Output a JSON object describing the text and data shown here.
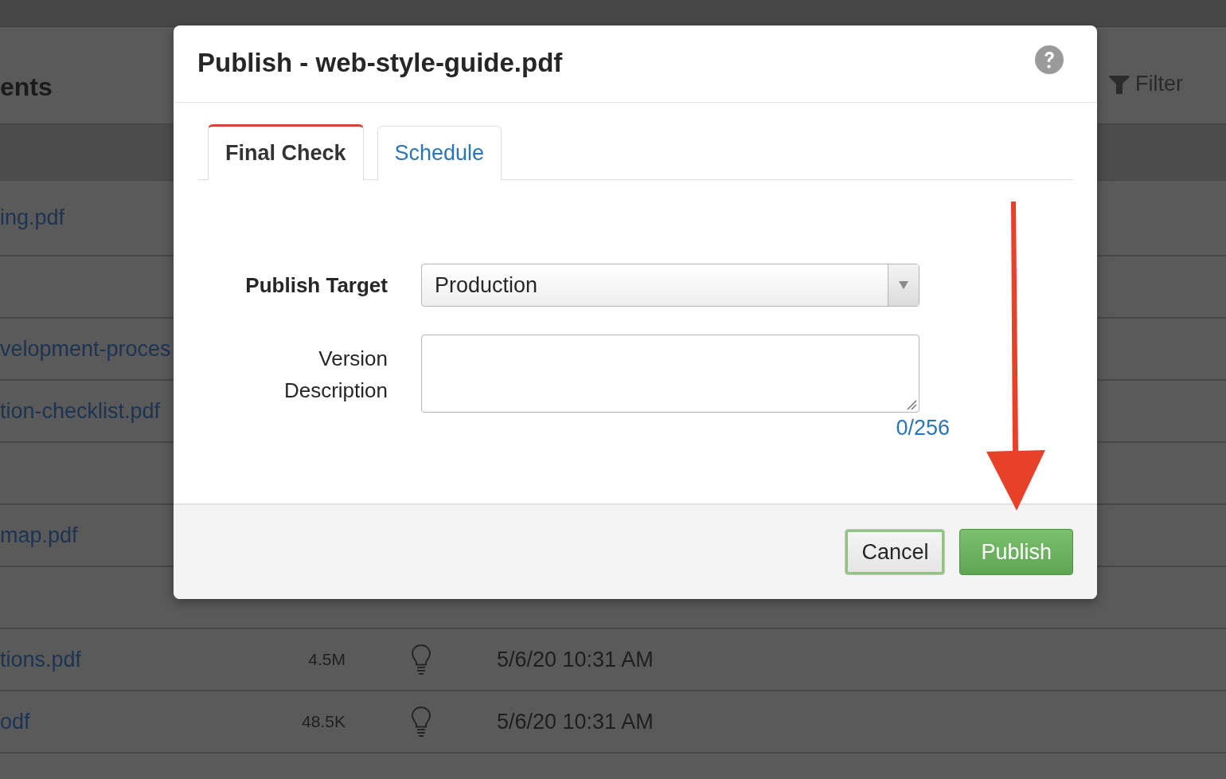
{
  "page": {
    "heading": "ents",
    "filter": "Filter"
  },
  "table": {
    "rows": [
      {
        "name": "ing.pdf"
      },
      {},
      {
        "name": "velopment-proces"
      },
      {
        "name": "tion-checklist.pdf"
      },
      {},
      {
        "name": "map.pdf"
      },
      {},
      {
        "name": "tions.pdf",
        "size": "4.5M",
        "modified": "5/6/20 10:31 AM"
      },
      {
        "name": "odf",
        "size": "48.5K",
        "modified": "5/6/20 10:31 AM"
      },
      {}
    ]
  },
  "dialog": {
    "title": "Publish - web-style-guide.pdf",
    "tabs": [
      {
        "label": "Final Check",
        "selected": true
      },
      {
        "label": "Schedule",
        "selected": false
      }
    ],
    "publish_target": {
      "label": "Publish Target",
      "value": "Production"
    },
    "version_description": {
      "label": "Version Description",
      "counter": "0/256"
    },
    "buttons": [
      {
        "label": "Cancel",
        "kind": "secondary",
        "focused": true
      },
      {
        "label": "Publish",
        "kind": "primary",
        "focused": false
      }
    ]
  }
}
